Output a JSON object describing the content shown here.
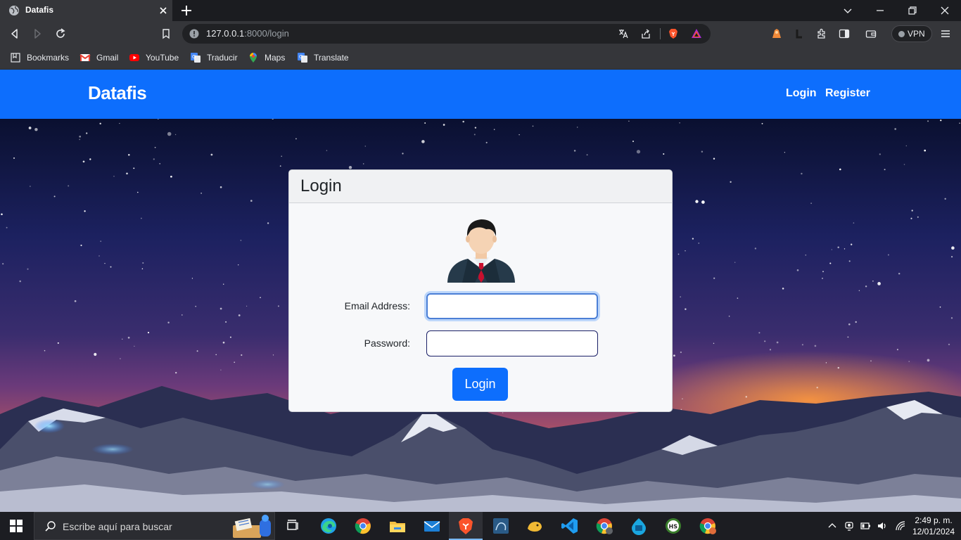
{
  "browser": {
    "tab_title": "Datafis",
    "url_host": "127.0.0.1",
    "url_rest": ":8000/login",
    "vpn_label": "VPN",
    "bookmarks": [
      {
        "label": "Bookmarks",
        "icon": "bookmarks-icon"
      },
      {
        "label": "Gmail",
        "icon": "gmail-icon"
      },
      {
        "label": "YouTube",
        "icon": "youtube-icon"
      },
      {
        "label": "Traducir",
        "icon": "translate-icon"
      },
      {
        "label": "Maps",
        "icon": "maps-icon"
      },
      {
        "label": "Translate",
        "icon": "translate-icon"
      }
    ]
  },
  "site": {
    "brand": "Datafis",
    "nav": {
      "login": "Login",
      "register": "Register"
    },
    "accent_color": "#0d6efd"
  },
  "login_card": {
    "title": "Login",
    "avatar_icon": "user-avatar-icon",
    "email_label": "Email Address:",
    "email_value": "",
    "password_label": "Password:",
    "password_value": "",
    "submit_label": "Login"
  },
  "taskbar": {
    "search_placeholder": "Escribe aquí para buscar",
    "time": "2:49 p. m.",
    "date": "12/01/2024"
  }
}
